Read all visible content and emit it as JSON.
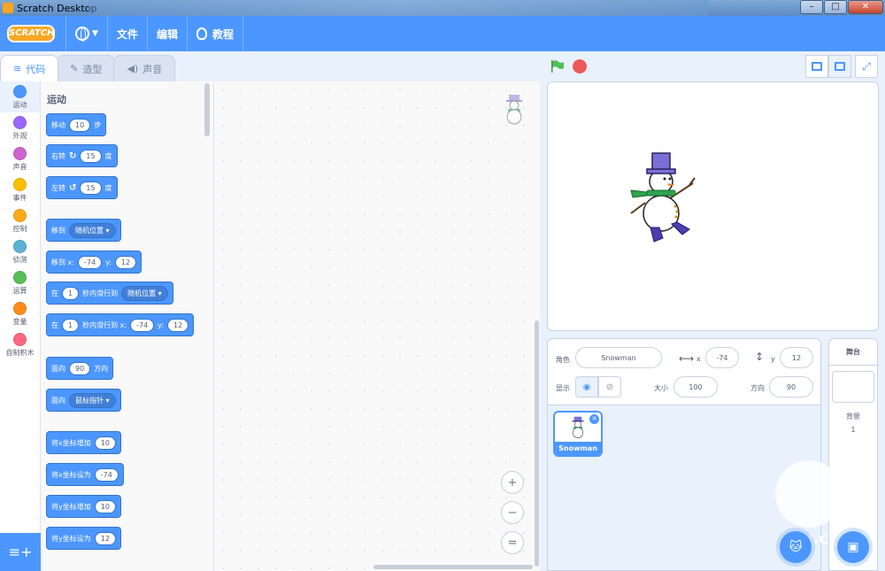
{
  "window": {
    "title": "Scratch Desktop"
  },
  "menu": {
    "logo": "SCRATCH",
    "file": "文件",
    "edit": "编辑",
    "tutorials": "教程"
  },
  "tabs": {
    "code": "代码",
    "costumes": "造型",
    "sounds": "声音"
  },
  "categories": [
    {
      "label": "运动",
      "color": "#4c97ff"
    },
    {
      "label": "外观",
      "color": "#9966ff"
    },
    {
      "label": "声音",
      "color": "#cf63cf"
    },
    {
      "label": "事件",
      "color": "#ffbf00"
    },
    {
      "label": "控制",
      "color": "#ffab19"
    },
    {
      "label": "侦测",
      "color": "#5cb1d6"
    },
    {
      "label": "运算",
      "color": "#59c059"
    },
    {
      "label": "变量",
      "color": "#ff8c1a"
    },
    {
      "label": "自制积木",
      "color": "#ff6680"
    }
  ],
  "palette": {
    "section_title": "运动",
    "move": {
      "label": "移动",
      "value": "10",
      "suffix": "步"
    },
    "turn_right": {
      "label": "右转",
      "value": "15",
      "suffix": "度"
    },
    "turn_left": {
      "label": "左转",
      "value": "15",
      "suffix": "度"
    },
    "goto": {
      "label": "移到",
      "dropdown": "随机位置"
    },
    "goto_xy": {
      "label": "移到 x:",
      "x": "-74",
      "ylabel": "y:",
      "y": "12"
    },
    "glide": {
      "label": "在",
      "secs": "1",
      "mid": "秒内滑行到",
      "dropdown": "随机位置"
    },
    "glide_xy": {
      "label": "在",
      "secs": "1",
      "mid": "秒内滑行到 x:",
      "x": "-74",
      "ylabel": "y:",
      "y": "12"
    },
    "point_dir": {
      "label": "面向",
      "value": "90",
      "suffix": "方向"
    },
    "point_towards": {
      "label": "面向",
      "dropdown": "鼠标指针"
    },
    "change_x": {
      "label": "将x坐标增加",
      "value": "10"
    },
    "set_x": {
      "label": "将x坐标设为",
      "value": "-74"
    },
    "change_y": {
      "label": "将y坐标增加",
      "value": "10"
    },
    "set_y": {
      "label": "将y坐标设为",
      "value": "12"
    }
  },
  "zoom": {
    "in": "+",
    "out": "−",
    "reset": "="
  },
  "sprite_info": {
    "sprite_label": "角色",
    "sprite_name": "Snowman",
    "x_label": "x",
    "x": "-74",
    "y_label": "y",
    "y": "12",
    "show_label": "显示",
    "size_label": "大小",
    "size": "100",
    "direction_label": "方向",
    "direction": "90"
  },
  "sprites": [
    {
      "name": "Snowman"
    }
  ],
  "stage_pane": {
    "title": "舞台",
    "backdrops_label": "背景",
    "backdrops_count": "1"
  },
  "watermark": "du.com"
}
